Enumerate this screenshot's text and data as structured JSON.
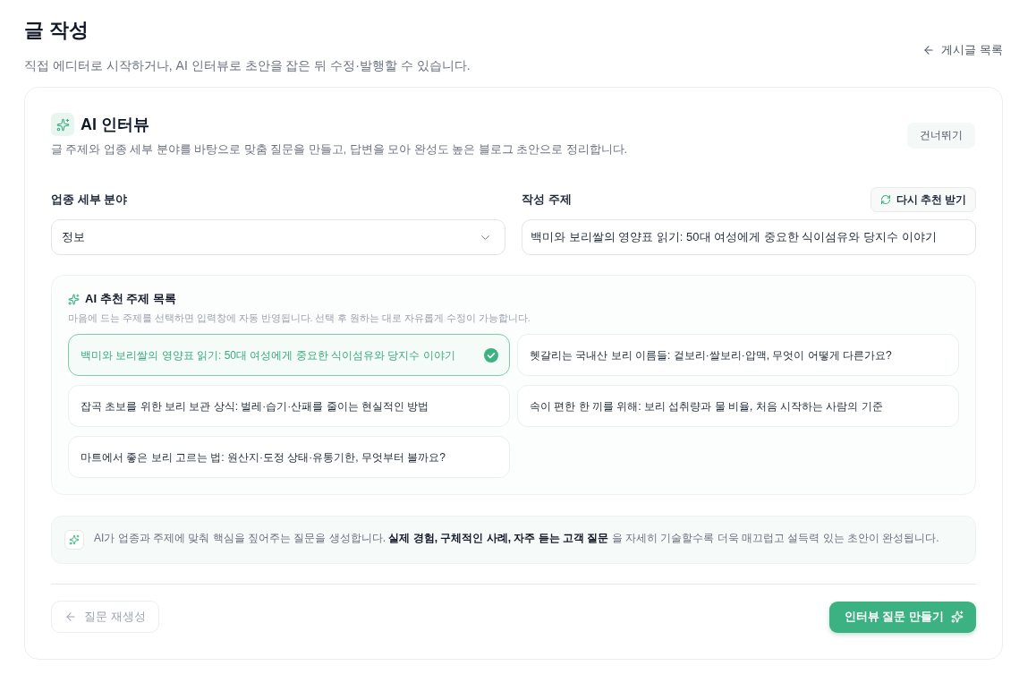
{
  "header": {
    "title": "글 작성",
    "subtitle": "직접 에디터로 시작하거나, AI 인터뷰로 초안을 잡은 뒤 수정·발행할 수 있습니다.",
    "back_link": "게시글 목록"
  },
  "interview": {
    "title": "AI 인터뷰",
    "description": "글 주제와 업종 세부 분야를 바탕으로 맞춤 질문을 만들고, 답변을 모아 완성도 높은 블로그 초안으로 정리합니다.",
    "skip_button": "건너뛰기"
  },
  "fields": {
    "category": {
      "label": "업종 세부 분야",
      "value": "정보"
    },
    "topic": {
      "label": "작성 주제",
      "value": "백미와 보리쌀의 영양표 읽기: 50대 여성에게 중요한 식이섬유와 당지수 이야기",
      "refresh_button": "다시 추천 받기"
    }
  },
  "suggestions": {
    "title": "AI 추천 주제 목록",
    "hint": "마음에 드는 주제를 선택하면 입력창에 자동 반영됩니다. 선택 후 원하는 대로 자유롭게 수정이 가능합니다.",
    "items": [
      {
        "text": "백미와 보리쌀의 영양표 읽기: 50대 여성에게 중요한 식이섬유와 당지수 이야기",
        "selected": true
      },
      {
        "text": "헷갈리는 국내산 보리 이름들: 겉보리·쌀보리·압맥, 무엇이 어떻게 다른가요?",
        "selected": false
      },
      {
        "text": "잡곡 초보를 위한 보리 보관 상식: 벌레·습기·산패를 줄이는 현실적인 방법",
        "selected": false
      },
      {
        "text": "속이 편한 한 끼를 위해: 보리 섭취량과 물 비율, 처음 시작하는 사람의 기준",
        "selected": false
      },
      {
        "text": "마트에서 좋은 보리 고르는 법: 원산지·도정 상태·유통기한, 무엇부터 볼까요?",
        "selected": false
      }
    ]
  },
  "tip": "AI가 업종과 주제에 맞춰 핵심을 짚어주는 질문을 생성합니다. **실제 경험, 구체적인 사례, 자주 듣는 고객 질문** 을 자세히 기술할수록 더욱 매끄럽고 설득력 있는 초안이 완성됩니다.",
  "footer": {
    "regenerate_button": {
      "label": "질문 재생성",
      "disabled": true
    },
    "create_button": "인터뷰 질문 만들기"
  }
}
